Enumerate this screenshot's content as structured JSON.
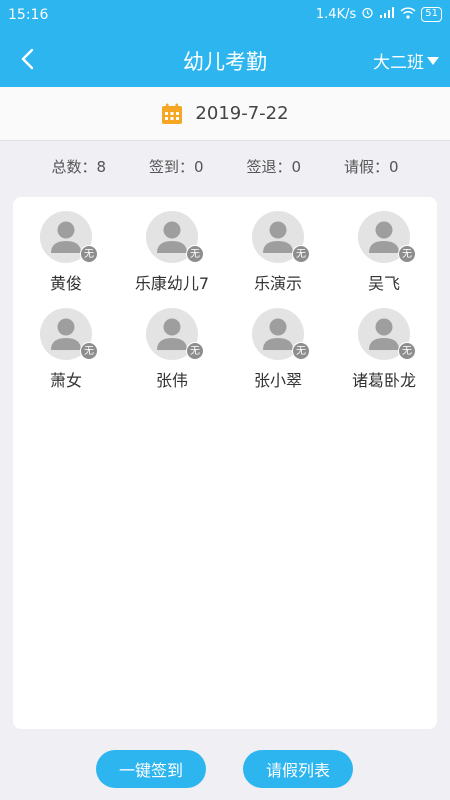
{
  "status": {
    "time": "15:16",
    "speed": "1.4K/s",
    "battery": "51"
  },
  "header": {
    "title": "幼儿考勤",
    "class_selector": "大二班"
  },
  "date": "2019-7-22",
  "stats": [
    {
      "label": "总数：8"
    },
    {
      "label": "签到：0"
    },
    {
      "label": "签退：0"
    },
    {
      "label": "请假：0"
    }
  ],
  "children": [
    {
      "name": "黄俊",
      "status": "无"
    },
    {
      "name": "乐康幼儿7",
      "status": "无"
    },
    {
      "name": "乐演示",
      "status": "无"
    },
    {
      "name": "吴飞",
      "status": "无"
    },
    {
      "name": "萧女",
      "status": "无"
    },
    {
      "name": "张伟",
      "status": "无"
    },
    {
      "name": "张小翠",
      "status": "无"
    },
    {
      "name": "诸葛卧龙",
      "status": "无"
    }
  ],
  "actions": {
    "sign_in_all": "一键签到",
    "leave_list": "请假列表"
  },
  "colors": {
    "primary": "#2cb5ef",
    "calendar": "#f5a623",
    "background": "#efeff4"
  }
}
